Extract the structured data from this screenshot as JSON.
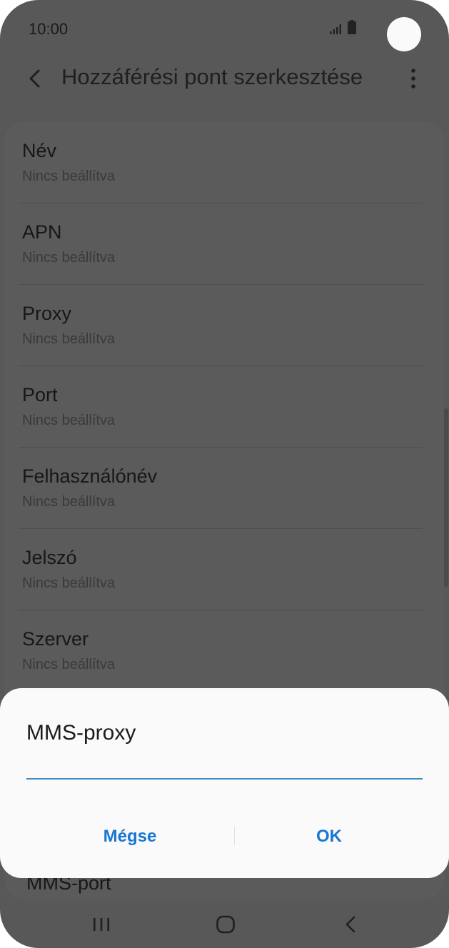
{
  "status": {
    "time": "10:00"
  },
  "header": {
    "title": "Hozzáférési pont szerkesztése"
  },
  "list": {
    "items": [
      {
        "title": "Név",
        "subtitle": "Nincs beállítva"
      },
      {
        "title": "APN",
        "subtitle": "Nincs beállítva"
      },
      {
        "title": "Proxy",
        "subtitle": "Nincs beállítva"
      },
      {
        "title": "Port",
        "subtitle": "Nincs beállítva"
      },
      {
        "title": "Felhasználónév",
        "subtitle": "Nincs beállítva"
      },
      {
        "title": "Jelszó",
        "subtitle": "Nincs beállítva"
      },
      {
        "title": "Szerver",
        "subtitle": "Nincs beállítva"
      }
    ],
    "partial_item": "MMS-port"
  },
  "dialog": {
    "title": "MMS-proxy",
    "input_value": "",
    "cancel_label": "Mégse",
    "ok_label": "OK"
  },
  "colors": {
    "accent": "#1976d2",
    "input_line": "#3e8dc1",
    "dim_background": "#585858"
  },
  "icons": {
    "back": "back-arrow-icon",
    "more": "more-vert-icon",
    "nav_recents": "recent-apps-icon",
    "nav_home": "home-icon",
    "nav_back": "nav-back-icon"
  }
}
